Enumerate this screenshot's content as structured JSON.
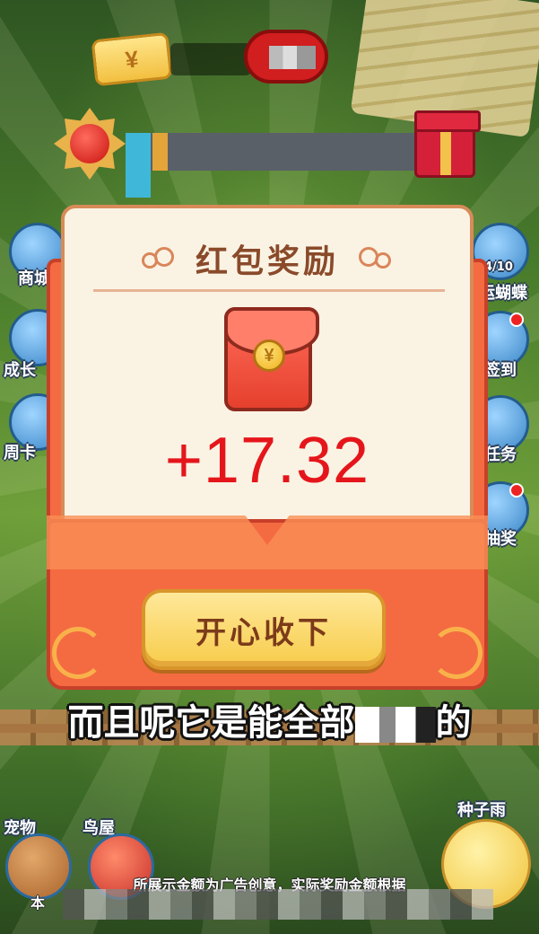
{
  "hud": {
    "currency_symbol": "¥",
    "progress_fraction": 0.05
  },
  "side_menu_left": [
    {
      "label": "商城",
      "icon": "shop-icon"
    },
    {
      "label": "成长",
      "icon": "growth-icon"
    },
    {
      "label": "周卡",
      "icon": "weekly-card-icon"
    }
  ],
  "side_menu_right": [
    {
      "label": "运蝴蝶",
      "icon": "butterfly-icon",
      "counter": "4/10"
    },
    {
      "label": "签到",
      "icon": "checkin-icon"
    },
    {
      "label": "任务",
      "icon": "trophy-icon"
    },
    {
      "label": "抽奖",
      "icon": "lottery-icon"
    }
  ],
  "bottom_menu": [
    {
      "label": "宠物",
      "icon": "pet-dog-icon"
    },
    {
      "label": "鸟屋",
      "icon": "bird-house-icon"
    },
    {
      "label": "种子雨",
      "icon": "seed-rain-icon"
    }
  ],
  "modal": {
    "title": "红包奖励",
    "envelope_coin_symbol": "¥",
    "amount": "+17.32",
    "claim_button": "开心收下"
  },
  "subtitle": {
    "prefix": "而且呢它是能全部",
    "suffix": "的"
  },
  "disclaimer": {
    "line1": "所展示金额为广告创意，实际奖励金额根据",
    "line2": "本"
  },
  "colors": {
    "amount_red": "#e5161b",
    "envelope_red": "#f46b42",
    "button_yellow": "#f7cc4a",
    "title_brown": "#8a4a2a"
  }
}
